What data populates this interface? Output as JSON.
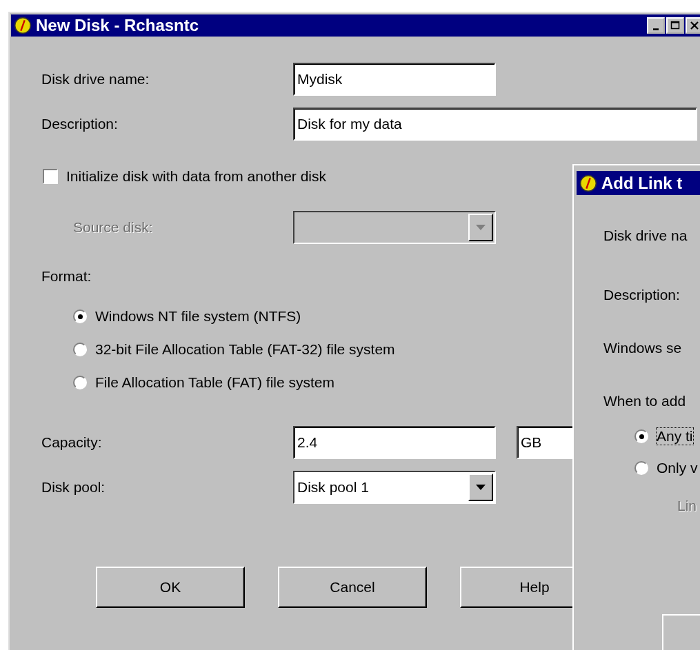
{
  "window": {
    "title": "New Disk - Rchasntc"
  },
  "fields": [
    {
      "kind": "text",
      "label": "Disk drive name:",
      "value": "Mydisk",
      "wide": false
    },
    {
      "kind": "text",
      "label": "Description:",
      "value": "Disk for my data",
      "wide": true
    }
  ],
  "init_checkbox": {
    "label": "Initialize disk with data from another disk",
    "checked": false
  },
  "source_disk": {
    "label": "Source disk:",
    "disabled": true
  },
  "format": {
    "label": "Format:",
    "options": [
      {
        "label": "Windows NT file system (NTFS)",
        "selected": true
      },
      {
        "label": "32-bit File Allocation Table (FAT-32) file system",
        "selected": false
      },
      {
        "label": "File Allocation Table (FAT) file system",
        "selected": false
      }
    ]
  },
  "capacity": {
    "label": "Capacity:",
    "value": "2.4",
    "unit": "GB"
  },
  "disk_pool": {
    "label": "Disk pool:",
    "value": "Disk pool 1"
  },
  "buttons": [
    "OK",
    "Cancel",
    "Help"
  ],
  "dialog": {
    "title": "Add Link t",
    "labels": [
      "Disk drive na",
      "Description:",
      "Windows se",
      "When to add"
    ],
    "options": [
      {
        "label": "Any ti",
        "selected": true,
        "focused": true
      },
      {
        "label": "Only v",
        "selected": false,
        "focused": false
      }
    ],
    "sub_label": {
      "text": "Lin",
      "disabled": true
    }
  }
}
